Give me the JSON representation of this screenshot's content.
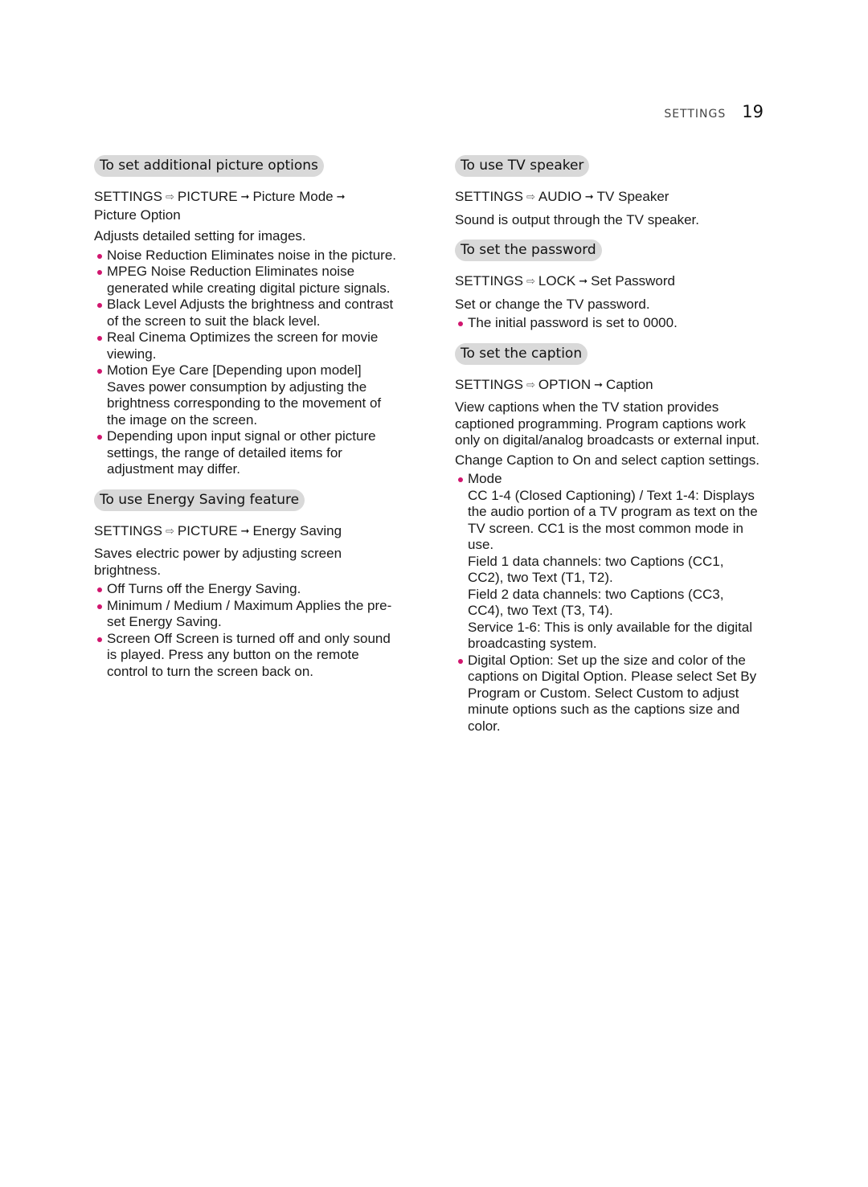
{
  "header": {
    "section": "SETTINGS",
    "page_number": "19"
  },
  "accent_color": "#d0156e",
  "left": {
    "picture_options": {
      "title": "To set additional picture options",
      "path": [
        "SETTINGS",
        "PICTURE",
        "Picture Mode",
        "Picture Option"
      ],
      "description": "Adjusts detailed setting for images.",
      "bullets": [
        "Noise Reduction Eliminates noise in the picture.",
        "MPEG Noise Reduction Eliminates noise generated while creating digital picture signals.",
        "Black Level Adjusts the brightness and contrast of the screen to suit the black level.",
        "Real Cinema Optimizes the screen for movie viewing.",
        "Motion Eye Care [Depending upon model] Saves power consumption by adjusting the brightness corresponding to the movement of the image on the screen.",
        "Depending upon input signal or other picture settings, the range of detailed items for adjustment may differ."
      ]
    },
    "energy_saving": {
      "title": "To use Energy Saving feature",
      "path": [
        "SETTINGS",
        "PICTURE",
        "Energy Saving"
      ],
      "description": "Saves electric power by adjusting screen brightness.",
      "bullets": [
        "Off Turns off the Energy Saving.",
        "Minimum / Medium / Maximum Applies the pre-set Energy Saving.",
        "Screen Off Screen is turned off and only sound is played. Press any button on the remote control to turn the screen back on."
      ]
    }
  },
  "right": {
    "tv_speaker": {
      "title": "To use TV speaker",
      "path": [
        "SETTINGS",
        "AUDIO",
        "TV Speaker"
      ],
      "description": "Sound is output through the TV speaker."
    },
    "password": {
      "title": "To set the password",
      "path": [
        "SETTINGS",
        "LOCK",
        "Set Password"
      ],
      "description": "Set or change the TV password.",
      "bullets": [
        "The initial password is set to 0000."
      ]
    },
    "caption": {
      "title": "To set the caption",
      "path": [
        "SETTINGS",
        "OPTION",
        "Caption"
      ],
      "description": "View captions when the TV station provides captioned programming. Program captions work only on digital/analog broadcasts or external input.",
      "description2": "Change Caption to On and select caption settings.",
      "mode": {
        "label": "Mode",
        "lines": [
          "CC 1-4 (Closed Captioning) / Text 1-4: Displays the audio portion of a TV program as text on the TV screen. CC1 is the most common mode in use.",
          "Field 1 data channels: two Captions (CC1, CC2), two Text (T1, T2).",
          "Field 2 data channels: two Captions (CC3, CC4), two Text (T3, T4).",
          "Service 1-6: This is only available for the digital broadcasting system."
        ]
      },
      "digital_option": "Digital Option: Set up the size and color of the captions on Digital Option. Please select Set By Program or Custom. Select Custom to adjust minute options such as the captions  size and color."
    }
  }
}
